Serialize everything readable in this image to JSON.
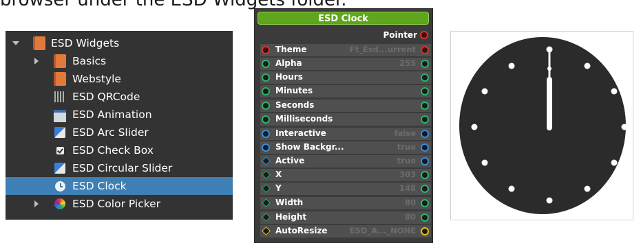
{
  "intro_text": "browser under the ESD Widgets folder.",
  "tree": {
    "items": [
      {
        "label": "ESD Widgets",
        "icon": "book-icon",
        "arrow": "down"
      },
      {
        "label": "Basics",
        "icon": "book-icon",
        "arrow": "right"
      },
      {
        "label": "Webstyle",
        "icon": "book-icon",
        "arrow": ""
      },
      {
        "label": "ESD QRCode",
        "icon": "qrcode-icon",
        "arrow": ""
      },
      {
        "label": "ESD Animation",
        "icon": "animation-icon",
        "arrow": ""
      },
      {
        "label": "ESD Arc Slider",
        "icon": "arc-slider-icon",
        "arrow": ""
      },
      {
        "label": "ESD Check Box",
        "icon": "checkbox-icon",
        "arrow": ""
      },
      {
        "label": "ESD Circular Slider",
        "icon": "circular-slider-icon",
        "arrow": ""
      },
      {
        "label": "ESD Clock",
        "icon": "clock-icon",
        "arrow": "",
        "selected": true
      },
      {
        "label": "ESD Color Picker",
        "icon": "color-picker-icon",
        "arrow": "right"
      }
    ],
    "colors": {
      "background": "#333333",
      "selected": "#3e7fb5"
    }
  },
  "properties": {
    "title": "ESD Clock",
    "pointer_label": "Pointer",
    "rows": [
      {
        "name": "Theme",
        "value": "Ft_Esd...urrent",
        "left_port": "red",
        "right_port": "red"
      },
      {
        "name": "Alpha",
        "value": "255",
        "left_port": "green",
        "right_port": "green"
      },
      {
        "name": "Hours",
        "value": "",
        "left_port": "green",
        "right_port": "green"
      },
      {
        "name": "Minutes",
        "value": "",
        "left_port": "green",
        "right_port": "green"
      },
      {
        "name": "Seconds",
        "value": "",
        "left_port": "green",
        "right_port": "green"
      },
      {
        "name": "Milliseconds",
        "value": "",
        "left_port": "green",
        "right_port": "green"
      },
      {
        "name": "Interactive",
        "value": "false",
        "left_port": "blue",
        "right_port": "blue"
      },
      {
        "name": "Show Backgr...",
        "value": "true",
        "left_port": "blue",
        "right_port": "blue"
      },
      {
        "name": "Active",
        "value": "true",
        "left_port": "blue-diamond",
        "right_port": "blue"
      },
      {
        "name": "X",
        "value": "303",
        "left_port": "green-diamond",
        "right_port": "green"
      },
      {
        "name": "Y",
        "value": "148",
        "left_port": "green-diamond",
        "right_port": "green"
      },
      {
        "name": "Width",
        "value": "80",
        "left_port": "green-diamond",
        "right_port": "green"
      },
      {
        "name": "Height",
        "value": "80",
        "left_port": "green-diamond",
        "right_port": "green"
      },
      {
        "name": "AutoResize",
        "value": "ESD_A..._NONE",
        "left_port": "yellow-diamond",
        "right_port": "yellow"
      }
    ],
    "colors": {
      "title_bg": "#5fa51d",
      "row_bg": "#4f4f4f",
      "panel_bg": "#3b3b3b"
    }
  },
  "clock": {
    "face_color": "#2b2b2b",
    "dot_color": "#ffffff",
    "hand_color": "#ffffff"
  }
}
